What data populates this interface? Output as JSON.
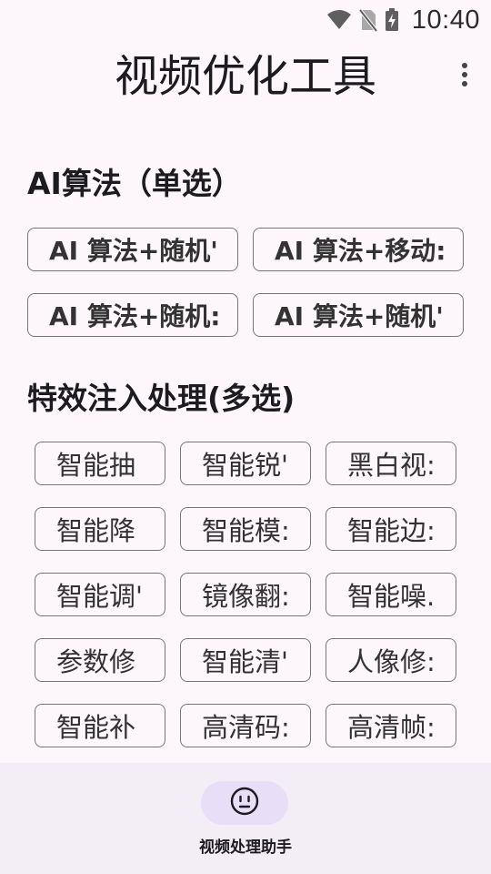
{
  "status_bar": {
    "time": "10:40",
    "icons": [
      "wifi-icon",
      "no-sim-icon",
      "battery-charging-icon"
    ]
  },
  "app_bar": {
    "title": "视频优化工具",
    "menu_icon": "more-vert-icon"
  },
  "algorithm_section": {
    "title": "AI算法（单选）",
    "options": [
      "AI 算法+随机'",
      "AI 算法+移动:",
      "AI 算法+随机:",
      "AI 算法+随机'"
    ]
  },
  "effects_section": {
    "title": "特效注入处理(多选)",
    "options": [
      "智能抽",
      "智能锐'",
      "黑白视:",
      "智能降",
      "智能模:",
      "智能边:",
      "智能调'",
      "镜像翻:",
      "智能噪.",
      "参数修",
      "智能清'",
      "人像修:",
      "智能补",
      "高清码:",
      "高清帧:"
    ]
  },
  "bottom_nav": {
    "label": "视频处理助手",
    "icon": "smiley-face-icon"
  },
  "colors": {
    "background": "#fdf7fb",
    "chip_border": "#79747e",
    "nav_background": "#f3edf6",
    "nav_indicator": "#e8def8"
  }
}
